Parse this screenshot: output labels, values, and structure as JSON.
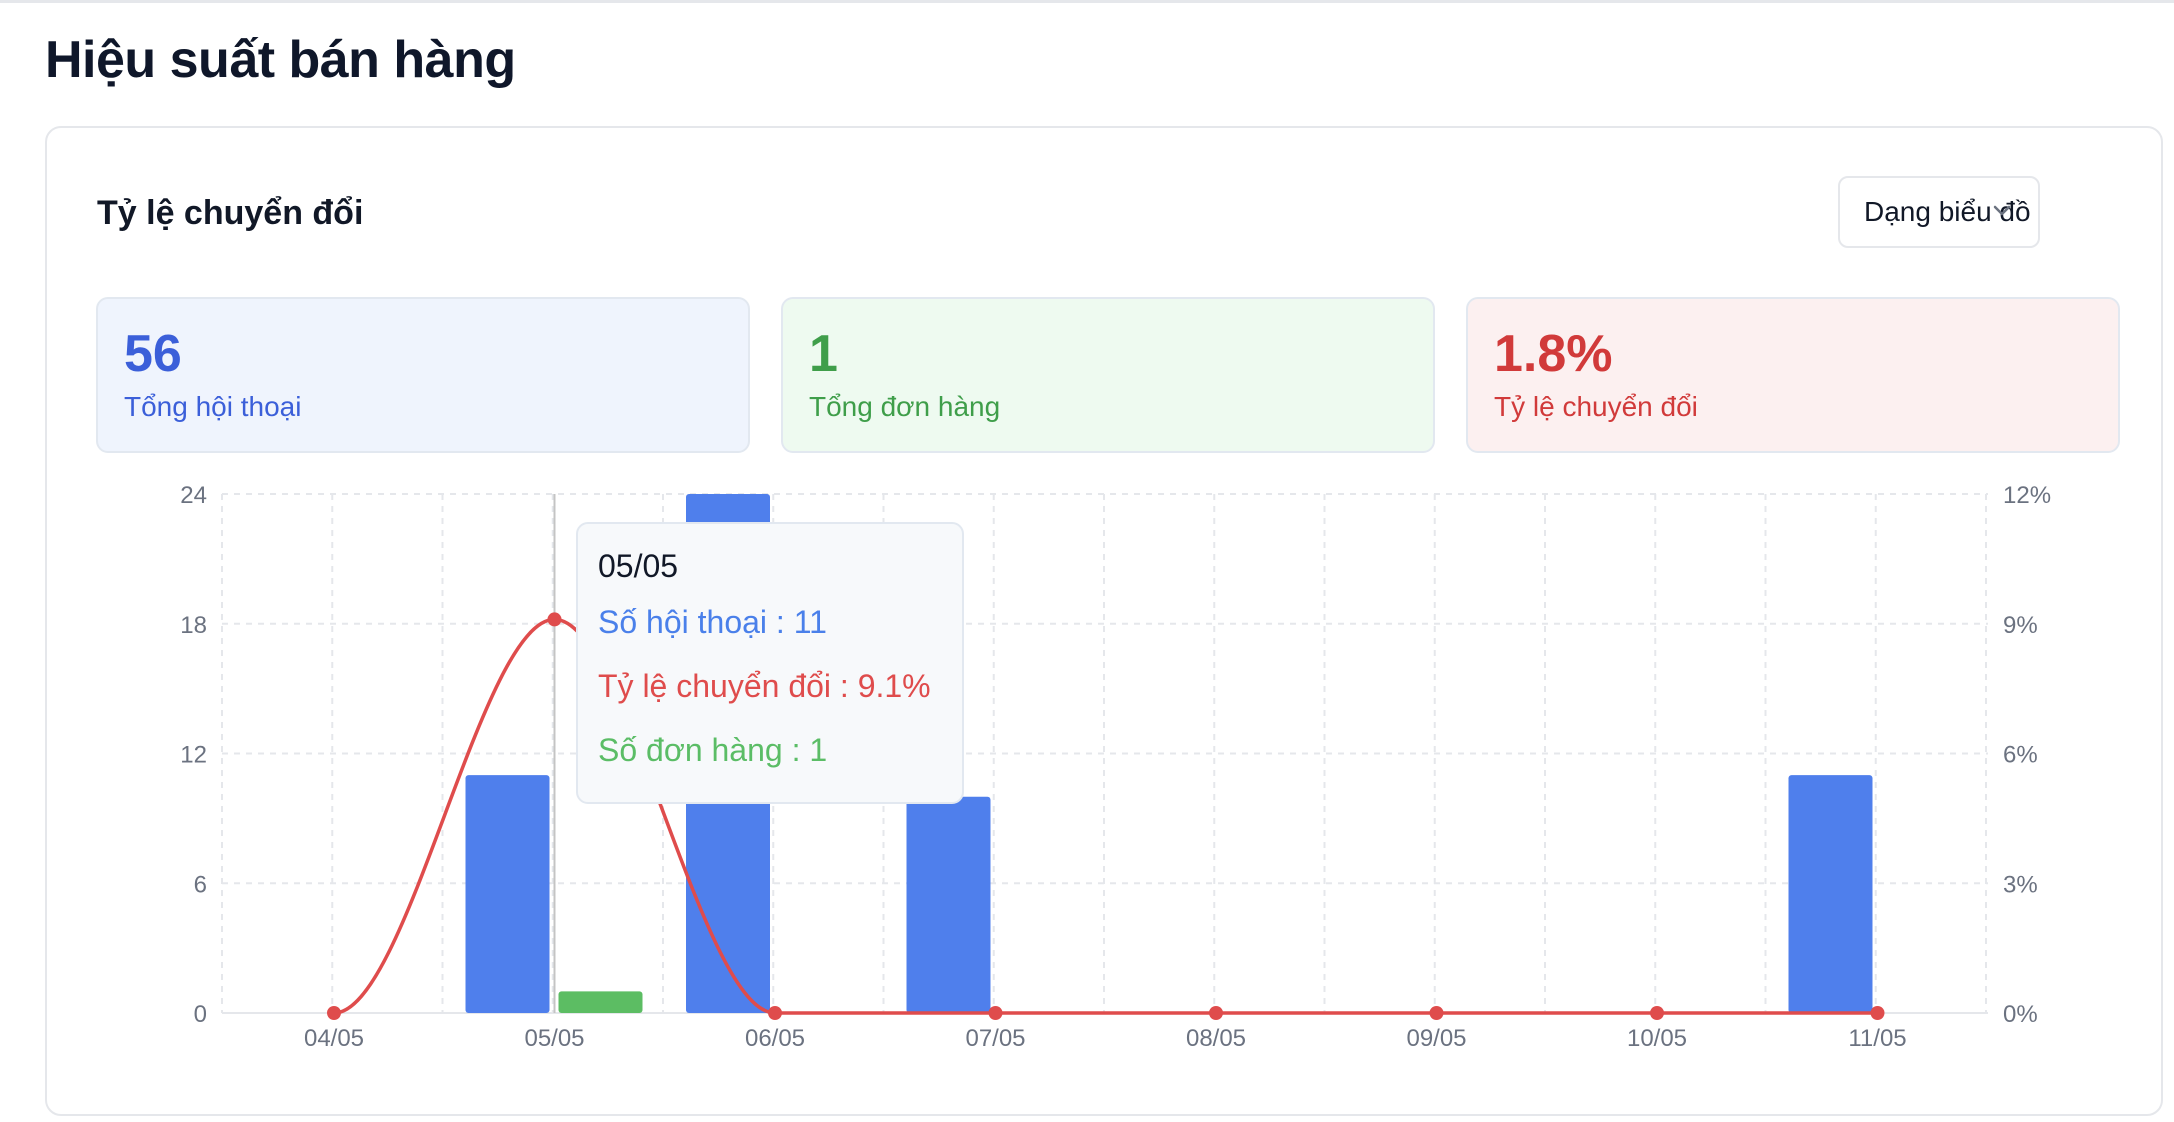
{
  "page": {
    "title": "Hiệu suất bán hàng"
  },
  "section": {
    "title": "Tỷ lệ chuyển đổi"
  },
  "dropdown": {
    "label": "Dạng biểu đồ",
    "icon": "chevron-down-icon"
  },
  "stats": [
    {
      "value": "56",
      "label": "Tổng hội thoại",
      "color": "#3b5fd9"
    },
    {
      "value": "1",
      "label": "Tổng đơn hàng",
      "color": "#3f9e4a"
    },
    {
      "value": "1.8%",
      "label": "Tỷ lệ chuyển đổi",
      "color": "#d13a3a"
    }
  ],
  "tooltip": {
    "date": "05/05",
    "conversations_text": "Số hội thoại : 11",
    "conversion_text": "Tỷ lệ chuyển đổi : 9.1%",
    "orders_text": "Số đơn hàng : 1"
  },
  "chart_data": {
    "type": "bar",
    "categories": [
      "04/05",
      "05/05",
      "06/05",
      "07/05",
      "08/05",
      "09/05",
      "10/05",
      "11/05"
    ],
    "series": [
      {
        "key": "conversations",
        "kind": "bar",
        "axis": "left",
        "color": "#4f7fec",
        "values": [
          0,
          11,
          24,
          10,
          0,
          0,
          0,
          11
        ]
      },
      {
        "key": "orders",
        "kind": "bar",
        "axis": "left",
        "color": "#5cbd63",
        "values": [
          0,
          1,
          0,
          0,
          0,
          0,
          0,
          0
        ]
      },
      {
        "key": "conversion",
        "kind": "line",
        "axis": "right",
        "color": "#df4c4c",
        "values": [
          0,
          9.1,
          0,
          0,
          0,
          0,
          0,
          0
        ]
      }
    ],
    "yleft": {
      "ticks": [
        0,
        6,
        12,
        18,
        24
      ],
      "lim": [
        0,
        24
      ]
    },
    "yright": {
      "ticks": [
        "0%",
        "3%",
        "6%",
        "9%",
        "12%"
      ],
      "lim": [
        0,
        12
      ]
    },
    "highlighted_category": "05/05",
    "grid": true
  }
}
